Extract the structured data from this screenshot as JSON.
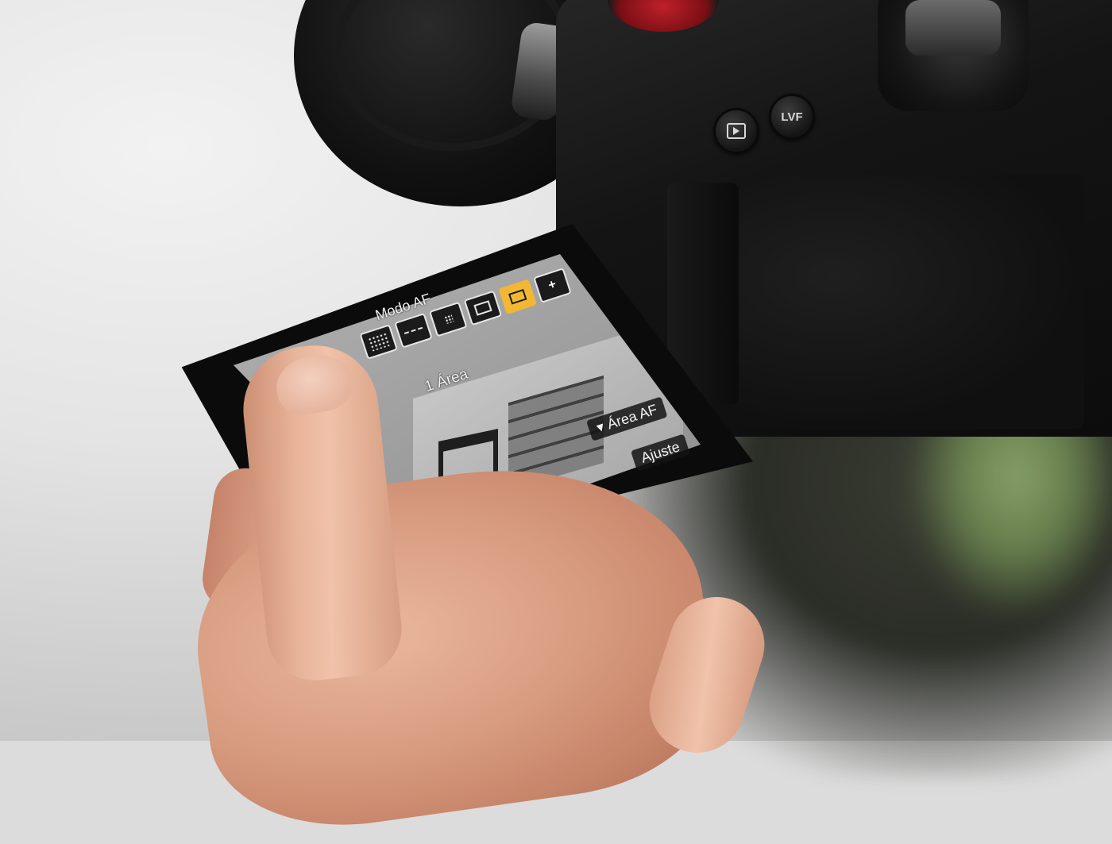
{
  "camera": {
    "buttons": {
      "play": "",
      "lvf": "LVF"
    }
  },
  "screen": {
    "menu_title": "Modo AF",
    "selected_mode": "1 Área",
    "chips": {
      "area_af": "▾ Área AF",
      "ajuste": "Ajuste"
    },
    "af_modes": [
      {
        "icon": "af-225-area-icon"
      },
      {
        "icon": "af-tracking-icon"
      },
      {
        "icon": "af-zone-icon"
      },
      {
        "icon": "af-zone-square-icon"
      },
      {
        "icon": "af-1-area-icon",
        "selected": true
      },
      {
        "icon": "af-1-area-plus-icon"
      }
    ],
    "accent_color": "#f2b733"
  }
}
